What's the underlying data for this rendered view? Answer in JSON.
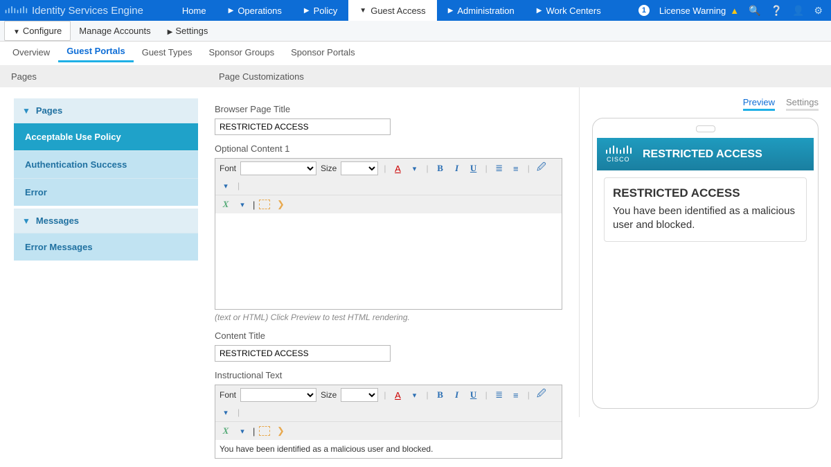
{
  "app": {
    "title": "Identity Services Engine"
  },
  "topnav": [
    {
      "label": "Home",
      "caret": false
    },
    {
      "label": "Operations",
      "caret": true
    },
    {
      "label": "Policy",
      "caret": true
    },
    {
      "label": "Guest Access",
      "caret": true,
      "active": true
    },
    {
      "label": "Administration",
      "caret": true
    },
    {
      "label": "Work Centers",
      "caret": true
    }
  ],
  "topright": {
    "badge": "1",
    "license": "License Warning"
  },
  "subbar1": [
    {
      "label": "Configure",
      "caret": true,
      "boxed": true
    },
    {
      "label": "Manage Accounts",
      "caret": false
    },
    {
      "label": "Settings",
      "caret": true
    }
  ],
  "subbar2": [
    {
      "label": "Overview"
    },
    {
      "label": "Guest Portals",
      "active": true
    },
    {
      "label": "Guest Types"
    },
    {
      "label": "Sponsor Groups"
    },
    {
      "label": "Sponsor Portals"
    }
  ],
  "ghead": {
    "left": "Pages",
    "right": "Page Customizations"
  },
  "leftgroups": {
    "pagesLabel": "Pages",
    "pageItems": [
      "Acceptable Use Policy",
      "Authentication Success",
      "Error"
    ],
    "selected": "Acceptable Use Policy",
    "messagesLabel": "Messages",
    "messageItems": [
      "Error Messages"
    ]
  },
  "form": {
    "browserTitleLabel": "Browser Page Title",
    "browserTitleValue": "RESTRICTED ACCESS",
    "optional1Label": "Optional Content 1",
    "fontLabel": "Font",
    "sizeLabel": "Size",
    "hint": "(text or HTML) Click Preview to test HTML rendering.",
    "contentTitleLabel": "Content Title",
    "contentTitleValue": "RESTRICTED ACCESS",
    "instructionalLabel": "Instructional Text",
    "instructionalValue": "You have been identified as a malicious user and blocked."
  },
  "preview": {
    "tabs": [
      {
        "label": "Preview",
        "active": true
      },
      {
        "label": "Settings"
      }
    ],
    "banner": "RESTRICTED ACCESS",
    "cardTitle": "RESTRICTED ACCESS",
    "cardBody": "You have been identified as a malicious user and blocked."
  }
}
